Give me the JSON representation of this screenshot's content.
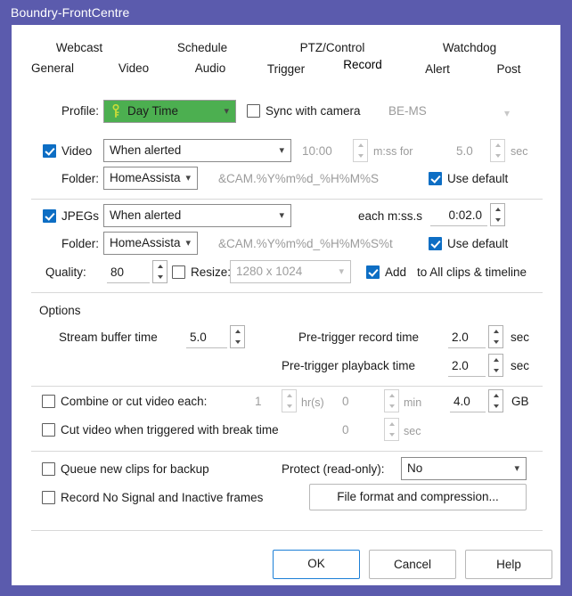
{
  "window": {
    "title": "Boundry-FrontCentre",
    "accent_border": "#5b5bad",
    "titlebar_bg": "#5b5bad",
    "client_bg": "#ffffff",
    "checked_color": "#0d6ec4",
    "profile_highlight": "#4caf50"
  },
  "tabs": {
    "top_row": [
      {
        "label": "Webcast"
      },
      {
        "label": "Schedule"
      },
      {
        "label": "PTZ/Control"
      },
      {
        "label": "Watchdog"
      }
    ],
    "bottom_row": [
      {
        "label": "General"
      },
      {
        "label": "Video"
      },
      {
        "label": "Audio"
      },
      {
        "label": "Trigger"
      },
      {
        "label": "Record"
      },
      {
        "label": "Alert"
      },
      {
        "label": "Post"
      }
    ],
    "selected": "Record"
  },
  "profile_row": {
    "label": "Profile:",
    "value": "Day Time",
    "icon": "key-icon",
    "sync_checkbox": {
      "label": "Sync with camera",
      "checked": false
    },
    "mode_value": "BE-MS"
  },
  "video_row": {
    "checkbox": {
      "label": "Video",
      "checked": true
    },
    "mode": "When alerted",
    "duration": "10:00",
    "duration_unit": "m:ss for",
    "post": "5.0",
    "post_unit": "sec",
    "folder_label": "Folder:",
    "folder_value": "HomeAssista",
    "mask": "&CAM.%Y%m%d_%H%M%S",
    "use_default": {
      "label": "Use default",
      "checked": true
    }
  },
  "jpegs_row": {
    "checkbox": {
      "label": "JPEGs",
      "checked": true
    },
    "mode": "When alerted",
    "each_label": "each m:ss.s",
    "each_value": "0:02.0",
    "folder_label": "Folder:",
    "folder_value": "HomeAssista",
    "mask": "&CAM.%Y%m%d_%H%M%S%t",
    "use_default": {
      "label": "Use default",
      "checked": true
    },
    "quality_label": "Quality:",
    "quality_value": "80",
    "resize": {
      "label": "Resize:",
      "checked": false,
      "value": "1280 x 1024"
    },
    "add_timeline": {
      "label": "Add",
      "suffix": "to All clips & timeline",
      "checked": true
    }
  },
  "options": {
    "group_label": "Options",
    "stream_buffer": {
      "label": "Stream buffer time",
      "value": "5.0"
    },
    "pre_record": {
      "label": "Pre-trigger record time",
      "value": "2.0",
      "unit": "sec"
    },
    "pre_playback": {
      "label": "Pre-trigger playback time",
      "value": "2.0",
      "unit": "sec"
    },
    "combine": {
      "label": "Combine or cut video each:",
      "checked": false,
      "hours": "1",
      "hours_unit": "hr(s)",
      "minutes": "0",
      "minutes_unit": "min",
      "size": "4.0",
      "size_unit": "GB"
    },
    "cut_break": {
      "label": "Cut video when triggered with break time",
      "checked": false,
      "value": "0",
      "unit": "sec"
    },
    "queue_backup": {
      "label": "Queue new clips for backup",
      "checked": false
    },
    "protect": {
      "label": "Protect (read-only):",
      "value": "No"
    },
    "record_nosignal": {
      "label": "Record No Signal and Inactive frames",
      "checked": false
    },
    "file_format_button": "File format and compression..."
  },
  "buttons": {
    "ok": "OK",
    "cancel": "Cancel",
    "help": "Help"
  }
}
